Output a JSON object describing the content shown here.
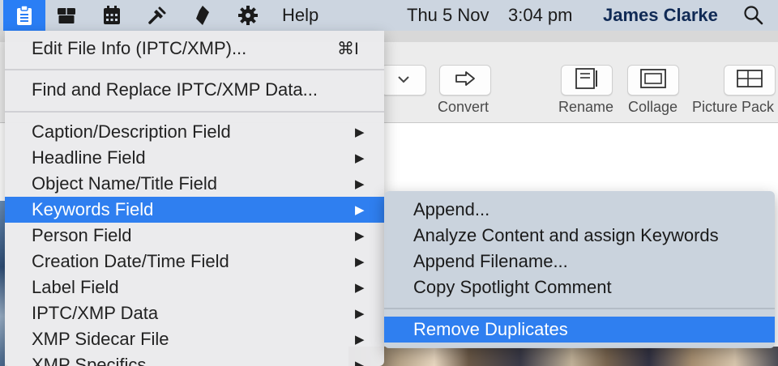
{
  "menubar": {
    "icons": [
      "clipboard-icon",
      "archive-box-icon",
      "calendar-icon",
      "tools-icon",
      "bookmark-tag-icon",
      "gear-icon"
    ],
    "help_label": "Help",
    "date": "Thu 5 Nov",
    "time": "3:04 pm",
    "user": "James Clarke",
    "search_icon": "magnifier-icon",
    "colors": {
      "background": "#ccd5e0",
      "app_icon_bg": "#2a7ef5",
      "user_text": "#102a55"
    }
  },
  "toolbar": {
    "buttons": [
      {
        "label": "Convert",
        "icon": "arrow-convert-icon"
      },
      {
        "label": "Rename",
        "icon": "rename-document-icon"
      },
      {
        "label": "Collage",
        "icon": "collage-icon"
      },
      {
        "label": "Picture Pack",
        "icon": "picture-pack-icon"
      }
    ],
    "popup_chevron": "chevron-down-icon"
  },
  "menu": {
    "items": [
      {
        "label": "Edit File Info (IPTC/XMP)...",
        "shortcut": "⌘I"
      },
      {
        "label": "Find and Replace IPTC/XMP Data..."
      },
      {
        "label": "Caption/Description Field",
        "submenu": true
      },
      {
        "label": "Headline Field",
        "submenu": true
      },
      {
        "label": "Object Name/Title Field",
        "submenu": true
      },
      {
        "label": "Keywords Field",
        "submenu": true,
        "highlighted": true
      },
      {
        "label": "Person Field",
        "submenu": true
      },
      {
        "label": "Creation Date/Time Field",
        "submenu": true
      },
      {
        "label": "Label Field",
        "submenu": true
      },
      {
        "label": "IPTC/XMP Data",
        "submenu": true
      },
      {
        "label": "XMP Sidecar File",
        "submenu": true
      },
      {
        "label": "XMP Specifics",
        "submenu": true
      }
    ],
    "arrow_glyph": "▶",
    "highlight_color": "#2f7ff0"
  },
  "submenu": {
    "items": [
      {
        "label": "Append..."
      },
      {
        "label": "Analyze Content and assign Keywords"
      },
      {
        "label": "Append Filename..."
      },
      {
        "label": "Copy Spotlight Comment"
      },
      {
        "label": "Remove Duplicates",
        "highlighted": true
      }
    ]
  }
}
